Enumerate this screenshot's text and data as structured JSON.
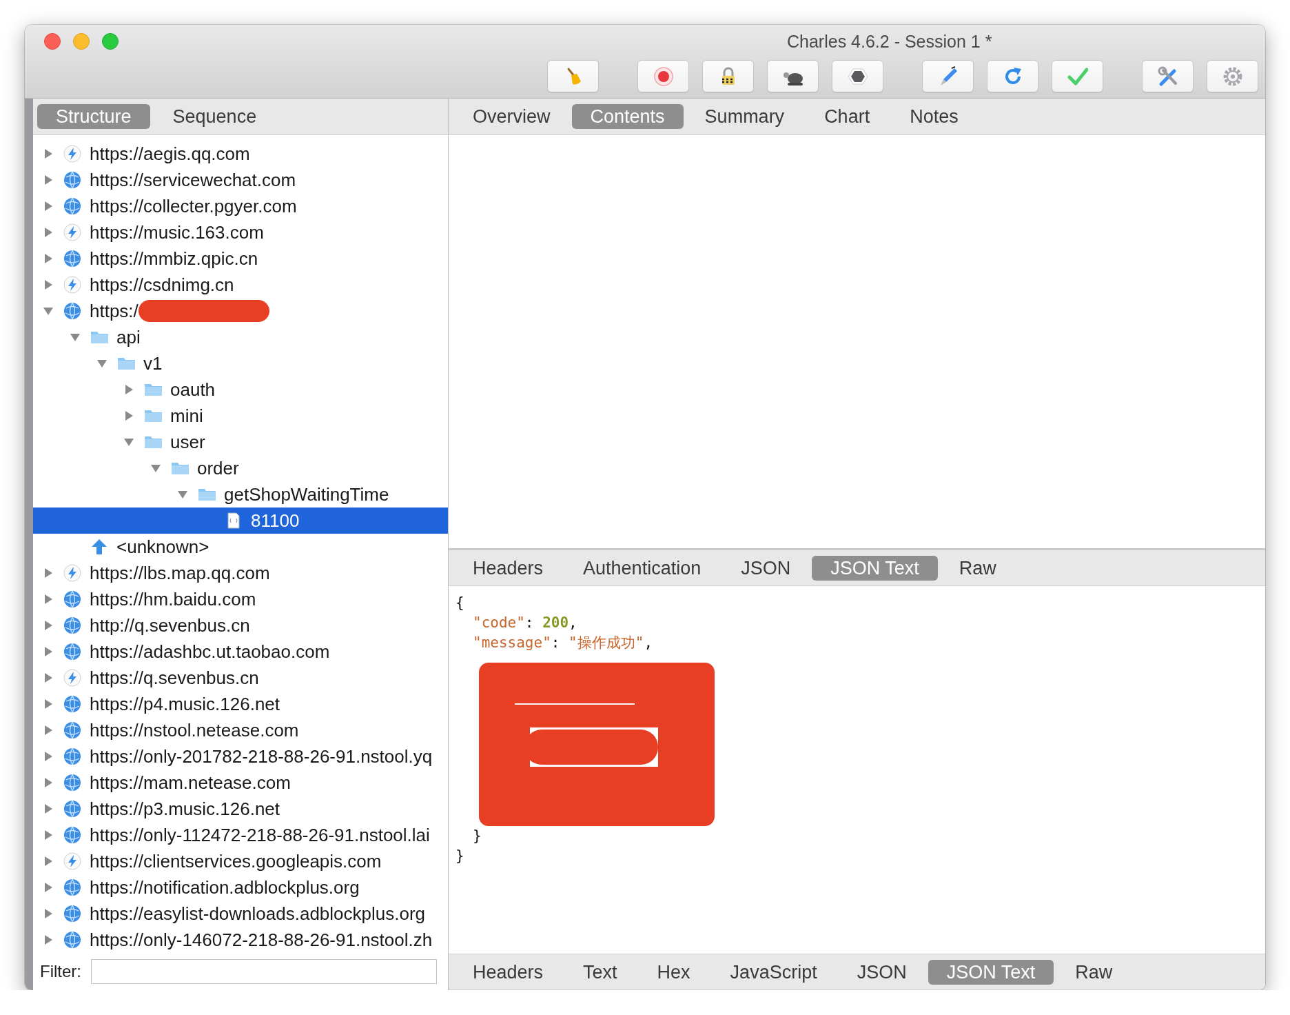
{
  "window": {
    "title": "Charles 4.6.2 - Session 1 *"
  },
  "toolbar": [
    {
      "kind": "broom"
    },
    {
      "kind": "record"
    },
    {
      "kind": "lock"
    },
    {
      "kind": "turtle"
    },
    {
      "kind": "stop"
    },
    {
      "kind": "pen"
    },
    {
      "kind": "refresh"
    },
    {
      "kind": "check"
    },
    {
      "kind": "tools"
    },
    {
      "kind": "gear"
    }
  ],
  "view_tabs": [
    {
      "label": "Structure",
      "selected": true
    },
    {
      "label": "Sequence",
      "selected": false
    }
  ],
  "tree": [
    {
      "label": "https://aegis.qq.com",
      "kind": "bolt",
      "expanded": false,
      "selected": false
    },
    {
      "label": "https://servicewechat.com",
      "kind": "globe",
      "expanded": false,
      "selected": false
    },
    {
      "label": "https://collecter.pgyer.com",
      "kind": "globe",
      "expanded": false,
      "selected": false
    },
    {
      "label": "https://music.163.com",
      "kind": "bolt",
      "expanded": false,
      "selected": false
    },
    {
      "label": "https://mmbiz.qpic.cn",
      "kind": "globe",
      "expanded": false,
      "selected": false
    },
    {
      "label": "https://csdnimg.cn",
      "kind": "bolt",
      "expanded": false,
      "selected": false
    },
    {
      "label": "https:/",
      "kind": "globe",
      "expanded": true,
      "selected": false,
      "redacted": true,
      "children": [
        {
          "label": "api",
          "kind": "folder",
          "expanded": true,
          "selected": false,
          "children": [
            {
              "label": "v1",
              "kind": "folder",
              "expanded": true,
              "selected": false,
              "children": [
                {
                  "label": "oauth",
                  "kind": "folder",
                  "expanded": false,
                  "selected": false
                },
                {
                  "label": "mini",
                  "kind": "folder",
                  "expanded": false,
                  "selected": false
                },
                {
                  "label": "user",
                  "kind": "folder",
                  "expanded": true,
                  "selected": false,
                  "children": [
                    {
                      "label": "order",
                      "kind": "folder",
                      "expanded": true,
                      "selected": false,
                      "children": [
                        {
                          "label": "getShopWaitingTime",
                          "kind": "folder",
                          "expanded": true,
                          "selected": false,
                          "children": [
                            {
                              "label": "81100",
                              "kind": "file",
                              "selected": true
                            }
                          ]
                        }
                      ]
                    }
                  ]
                }
              ]
            }
          ]
        },
        {
          "label": "<unknown>",
          "kind": "arrow",
          "selected": false
        }
      ]
    },
    {
      "label": "https://lbs.map.qq.com",
      "kind": "bolt",
      "expanded": false,
      "selected": false
    },
    {
      "label": "https://hm.baidu.com",
      "kind": "globe",
      "expanded": false,
      "selected": false
    },
    {
      "label": "http://q.sevenbus.cn",
      "kind": "globe",
      "expanded": false,
      "selected": false
    },
    {
      "label": "https://adashbc.ut.taobao.com",
      "kind": "globe",
      "expanded": false,
      "selected": false
    },
    {
      "label": "https://q.sevenbus.cn",
      "kind": "bolt",
      "expanded": false,
      "selected": false
    },
    {
      "label": "https://p4.music.126.net",
      "kind": "globe",
      "expanded": false,
      "selected": false
    },
    {
      "label": "https://nstool.netease.com",
      "kind": "globe",
      "expanded": false,
      "selected": false
    },
    {
      "label": "https://only-201782-218-88-26-91.nstool.yq",
      "kind": "globe",
      "expanded": false,
      "selected": false
    },
    {
      "label": "https://mam.netease.com",
      "kind": "globe",
      "expanded": false,
      "selected": false
    },
    {
      "label": "https://p3.music.126.net",
      "kind": "globe",
      "expanded": false,
      "selected": false
    },
    {
      "label": "https://only-112472-218-88-26-91.nstool.lai",
      "kind": "globe",
      "expanded": false,
      "selected": false
    },
    {
      "label": "https://clientservices.googleapis.com",
      "kind": "bolt",
      "expanded": false,
      "selected": false
    },
    {
      "label": "https://notification.adblockplus.org",
      "kind": "globe",
      "expanded": false,
      "selected": false
    },
    {
      "label": "https://easylist-downloads.adblockplus.org",
      "kind": "globe",
      "expanded": false,
      "selected": false
    },
    {
      "label": "https://only-146072-218-88-26-91.nstool.zh",
      "kind": "globe",
      "expanded": false,
      "selected": false
    }
  ],
  "filter": {
    "label": "Filter:"
  },
  "detail_tabs": [
    {
      "label": "Overview",
      "selected": false
    },
    {
      "label": "Contents",
      "selected": true
    },
    {
      "label": "Summary",
      "selected": false
    },
    {
      "label": "Chart",
      "selected": false
    },
    {
      "label": "Notes",
      "selected": false
    }
  ],
  "request": {
    "tabs": [
      {
        "label": "Headers",
        "selected": false
      },
      {
        "label": "Authentication",
        "selected": false
      },
      {
        "label": "JSON",
        "selected": false
      },
      {
        "label": "JSON Text",
        "selected": true
      },
      {
        "label": "Raw",
        "selected": false
      }
    ],
    "lines": [
      {
        "nested": false,
        "tokens": [
          {
            "kind": "punct",
            "text": "{"
          }
        ]
      },
      {
        "nested": true,
        "tokens": [
          {
            "kind": "key",
            "text": "\"code\""
          },
          {
            "kind": "punct",
            "text": ": "
          },
          {
            "kind": "number",
            "text": "200"
          },
          {
            "kind": "punct",
            "text": ","
          }
        ]
      },
      {
        "nested": true,
        "tokens": [
          {
            "kind": "key",
            "text": "\"message\""
          },
          {
            "kind": "punct",
            "text": ": "
          },
          {
            "kind": "string",
            "text": "\"操作成功\""
          },
          {
            "kind": "punct",
            "text": ","
          }
        ]
      }
    ],
    "redacted": true,
    "closing_lines": [
      {
        "nested": true,
        "tokens": [
          {
            "kind": "punct",
            "text": "}"
          }
        ]
      },
      {
        "nested": false,
        "tokens": [
          {
            "kind": "punct",
            "text": "}"
          }
        ]
      }
    ]
  },
  "response": {
    "tabs": [
      {
        "label": "Headers",
        "selected": false
      },
      {
        "label": "Text",
        "selected": false
      },
      {
        "label": "Hex",
        "selected": false
      },
      {
        "label": "JavaScript",
        "selected": false
      },
      {
        "label": "JSON",
        "selected": false
      },
      {
        "label": "JSON Text",
        "selected": true
      },
      {
        "label": "Raw",
        "selected": false
      }
    ]
  }
}
